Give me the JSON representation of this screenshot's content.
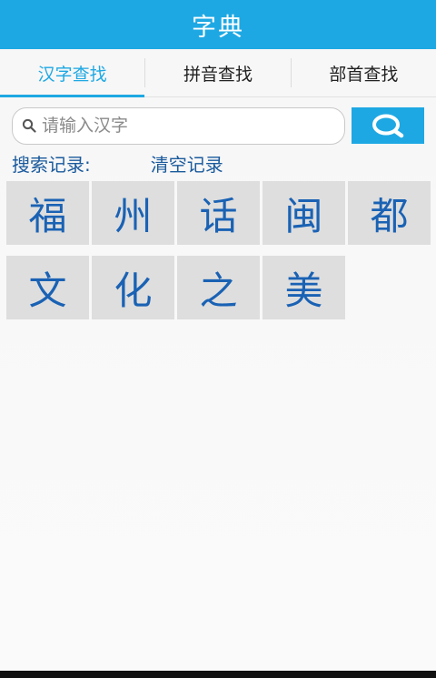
{
  "header": {
    "title": "字典"
  },
  "tabs": [
    {
      "label": "汉字查找",
      "active": true
    },
    {
      "label": "拼音查找",
      "active": false
    },
    {
      "label": "部首查找",
      "active": false
    }
  ],
  "search": {
    "placeholder": "请输入汉字",
    "value": "",
    "input_icon": "search-icon",
    "button_icon": "search-icon"
  },
  "history": {
    "label": "搜索记录:",
    "clear_label": "清空记录",
    "items": [
      "福",
      "州",
      "话",
      "闽",
      "都",
      "文",
      "化",
      "之",
      "美"
    ]
  },
  "colors": {
    "accent": "#1ea8e3",
    "char_text": "#1a62b4",
    "history_text": "#1a5a9c",
    "cell_bg": "#dedede"
  }
}
